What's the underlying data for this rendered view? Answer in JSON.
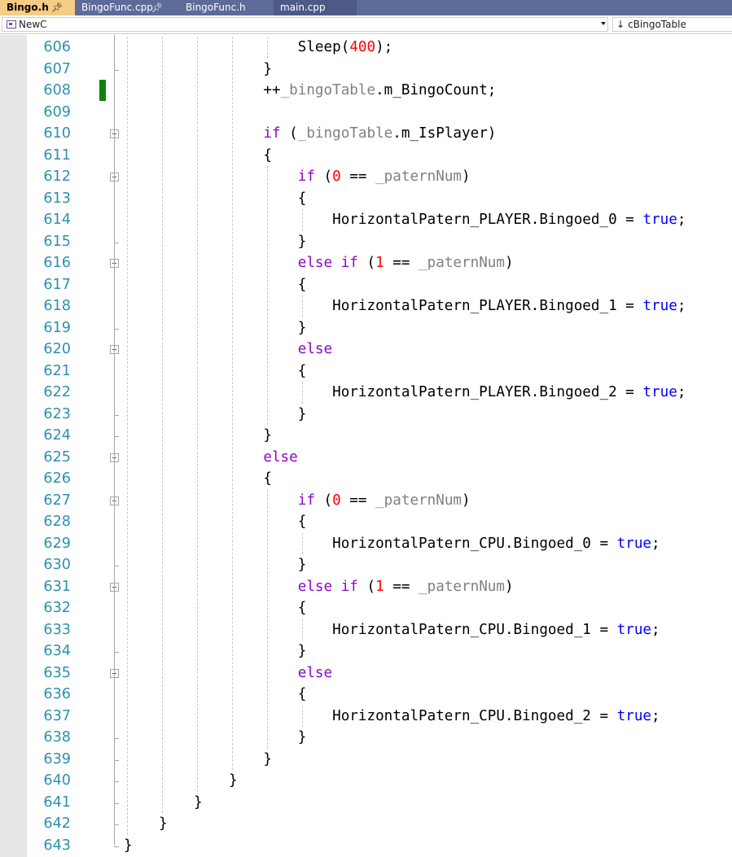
{
  "tabs": [
    {
      "label": "Bingo.h",
      "pin": "ꟷ",
      "active": true
    },
    {
      "label": "BingoFunc.cpp",
      "pin": "ꟷ",
      "active": false
    },
    {
      "label": "BingoFunc.h",
      "active": false
    },
    {
      "label": "main.cpp",
      "active": false
    }
  ],
  "nav": {
    "scope": "NewC",
    "member_icon": "↓",
    "member": "cBingoTable"
  },
  "colors": {
    "keyword_blue": "#0000ff",
    "keyword_purple": "#8f08c4",
    "number_red": "#ff0000",
    "variable_gray": "#808080",
    "line_number": "#2b91af",
    "change_marker": "#108010",
    "tab_active": "#f5cc84",
    "tab_bar": "#5d6b99"
  },
  "editor": {
    "lines": [
      {
        "n": "606",
        "tokens": [
          [
            "        Sleep(",
            ""
          ],
          [
            "400",
            "num"
          ],
          [
            ");",
            ""
          ]
        ],
        "indent": 3
      },
      {
        "n": "607",
        "tokens": [
          [
            "    }",
            ""
          ]
        ],
        "indent": 3
      },
      {
        "n": "608",
        "tokens": [
          [
            "    ++",
            ""
          ],
          [
            "_bingoTable",
            "var"
          ],
          [
            ".m_BingoCount;",
            ""
          ]
        ],
        "indent": 3
      },
      {
        "n": "609",
        "tokens": [
          [
            "",
            ""
          ]
        ],
        "indent": 3
      },
      {
        "n": "610",
        "tokens": [
          [
            "    ",
            ""
          ],
          [
            "if",
            "kwc"
          ],
          [
            " (",
            ""
          ],
          [
            "_bingoTable",
            "var"
          ],
          [
            ".m_IsPlayer)",
            ""
          ]
        ],
        "indent": 3
      },
      {
        "n": "611",
        "tokens": [
          [
            "    {",
            ""
          ]
        ],
        "indent": 3
      },
      {
        "n": "612",
        "tokens": [
          [
            "        ",
            ""
          ],
          [
            "if",
            "kwc"
          ],
          [
            " (",
            ""
          ],
          [
            "0",
            "num"
          ],
          [
            " == ",
            ""
          ],
          [
            "_paternNum",
            "var"
          ],
          [
            ")",
            ""
          ]
        ],
        "indent": 3
      },
      {
        "n": "613",
        "tokens": [
          [
            "        {",
            ""
          ]
        ],
        "indent": 3
      },
      {
        "n": "614",
        "tokens": [
          [
            "            HorizontalPatern_PLAYER.Bingoed_0 = ",
            ""
          ],
          [
            "true",
            "kw"
          ],
          [
            ";",
            ""
          ]
        ],
        "indent": 3
      },
      {
        "n": "615",
        "tokens": [
          [
            "        }",
            ""
          ]
        ],
        "indent": 3
      },
      {
        "n": "616",
        "tokens": [
          [
            "        ",
            ""
          ],
          [
            "else",
            "kwc"
          ],
          [
            " ",
            ""
          ],
          [
            "if",
            "kwc"
          ],
          [
            " (",
            ""
          ],
          [
            "1",
            "num"
          ],
          [
            " == ",
            ""
          ],
          [
            "_paternNum",
            "var"
          ],
          [
            ")",
            ""
          ]
        ],
        "indent": 3
      },
      {
        "n": "617",
        "tokens": [
          [
            "        {",
            ""
          ]
        ],
        "indent": 3
      },
      {
        "n": "618",
        "tokens": [
          [
            "            HorizontalPatern_PLAYER.Bingoed_1 = ",
            ""
          ],
          [
            "true",
            "kw"
          ],
          [
            ";",
            ""
          ]
        ],
        "indent": 3
      },
      {
        "n": "619",
        "tokens": [
          [
            "        }",
            ""
          ]
        ],
        "indent": 3
      },
      {
        "n": "620",
        "tokens": [
          [
            "        ",
            ""
          ],
          [
            "else",
            "kwc"
          ]
        ],
        "indent": 3
      },
      {
        "n": "621",
        "tokens": [
          [
            "        {",
            ""
          ]
        ],
        "indent": 3
      },
      {
        "n": "622",
        "tokens": [
          [
            "            HorizontalPatern_PLAYER.Bingoed_2 = ",
            ""
          ],
          [
            "true",
            "kw"
          ],
          [
            ";",
            ""
          ]
        ],
        "indent": 3
      },
      {
        "n": "623",
        "tokens": [
          [
            "        }",
            ""
          ]
        ],
        "indent": 3
      },
      {
        "n": "624",
        "tokens": [
          [
            "    }",
            ""
          ]
        ],
        "indent": 3
      },
      {
        "n": "625",
        "tokens": [
          [
            "    ",
            ""
          ],
          [
            "else",
            "kwc"
          ]
        ],
        "indent": 3
      },
      {
        "n": "626",
        "tokens": [
          [
            "    {",
            ""
          ]
        ],
        "indent": 3
      },
      {
        "n": "627",
        "tokens": [
          [
            "        ",
            ""
          ],
          [
            "if",
            "kwc"
          ],
          [
            " (",
            ""
          ],
          [
            "0",
            "num"
          ],
          [
            " == ",
            ""
          ],
          [
            "_paternNum",
            "var"
          ],
          [
            ")",
            ""
          ]
        ],
        "indent": 3
      },
      {
        "n": "628",
        "tokens": [
          [
            "        {",
            ""
          ]
        ],
        "indent": 3
      },
      {
        "n": "629",
        "tokens": [
          [
            "            HorizontalPatern_CPU.Bingoed_0 = ",
            ""
          ],
          [
            "true",
            "kw"
          ],
          [
            ";",
            ""
          ]
        ],
        "indent": 3
      },
      {
        "n": "630",
        "tokens": [
          [
            "        }",
            ""
          ]
        ],
        "indent": 3
      },
      {
        "n": "631",
        "tokens": [
          [
            "        ",
            ""
          ],
          [
            "else",
            "kwc"
          ],
          [
            " ",
            ""
          ],
          [
            "if",
            "kwc"
          ],
          [
            " (",
            ""
          ],
          [
            "1",
            "num"
          ],
          [
            " == ",
            ""
          ],
          [
            "_paternNum",
            "var"
          ],
          [
            ")",
            ""
          ]
        ],
        "indent": 3
      },
      {
        "n": "632",
        "tokens": [
          [
            "        {",
            ""
          ]
        ],
        "indent": 3
      },
      {
        "n": "633",
        "tokens": [
          [
            "            HorizontalPatern_CPU.Bingoed_1 = ",
            ""
          ],
          [
            "true",
            "kw"
          ],
          [
            ";",
            ""
          ]
        ],
        "indent": 3
      },
      {
        "n": "634",
        "tokens": [
          [
            "        }",
            ""
          ]
        ],
        "indent": 3
      },
      {
        "n": "635",
        "tokens": [
          [
            "        ",
            ""
          ],
          [
            "else",
            "kwc"
          ]
        ],
        "indent": 3
      },
      {
        "n": "636",
        "tokens": [
          [
            "        {",
            ""
          ]
        ],
        "indent": 3
      },
      {
        "n": "637",
        "tokens": [
          [
            "            HorizontalPatern_CPU.Bingoed_2 = ",
            ""
          ],
          [
            "true",
            "kw"
          ],
          [
            ";",
            ""
          ]
        ],
        "indent": 3
      },
      {
        "n": "638",
        "tokens": [
          [
            "        }",
            ""
          ]
        ],
        "indent": 3
      },
      {
        "n": "639",
        "tokens": [
          [
            "    }",
            ""
          ]
        ],
        "indent": 3
      },
      {
        "n": "640",
        "tokens": [
          [
            "}",
            ""
          ]
        ],
        "indent": 3
      },
      {
        "n": "641",
        "tokens": [
          [
            "}",
            ""
          ]
        ],
        "indent": 2
      },
      {
        "n": "642",
        "tokens": [
          [
            "}",
            ""
          ]
        ],
        "indent": 1
      },
      {
        "n": "643",
        "tokens": [
          [
            "}",
            ""
          ]
        ],
        "indent": 0
      }
    ],
    "changed_lines": [
      "608"
    ],
    "fold_lines": [
      "610",
      "612",
      "616",
      "620",
      "625",
      "627",
      "631",
      "635"
    ]
  }
}
